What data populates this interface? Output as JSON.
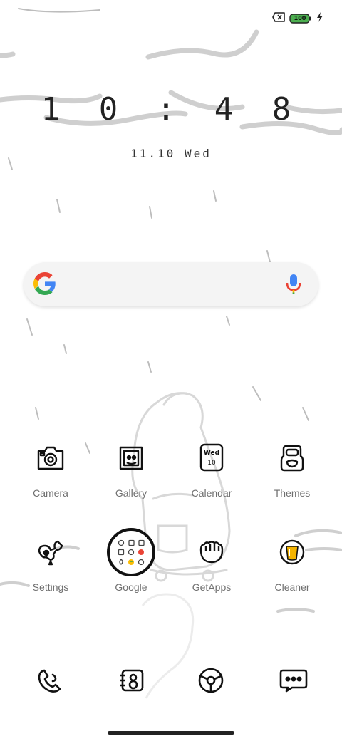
{
  "status": {
    "battery_level": "100",
    "sim_icon": "no-sim-icon",
    "charging_icon": "lightning-icon"
  },
  "clock": {
    "time": "1 0 : 4 8",
    "date": "11.10 Wed"
  },
  "search": {
    "logo": "google-g-icon",
    "mic": "mic-icon"
  },
  "apps": [
    {
      "label": "Camera",
      "icon": "camera-icon"
    },
    {
      "label": "Gallery",
      "icon": "gallery-icon"
    },
    {
      "label": "Calendar",
      "icon": "calendar-icon",
      "day": "Wed",
      "date": "10"
    },
    {
      "label": "Themes",
      "icon": "themes-icon"
    },
    {
      "label": "Settings",
      "icon": "settings-icon"
    },
    {
      "label": "Google",
      "icon": "google-folder-icon"
    },
    {
      "label": "GetApps",
      "icon": "getapps-icon"
    },
    {
      "label": "Cleaner",
      "icon": "cleaner-icon"
    }
  ],
  "dock": [
    {
      "icon": "phone-icon"
    },
    {
      "icon": "contacts-icon"
    },
    {
      "icon": "browser-icon"
    },
    {
      "icon": "messages-icon"
    }
  ],
  "colors": {
    "battery": "#4caf50",
    "cleaner": "#f5b400",
    "google_blue": "#4285F4",
    "google_red": "#EA4335",
    "google_yellow": "#FBBC05",
    "google_green": "#34A853"
  }
}
